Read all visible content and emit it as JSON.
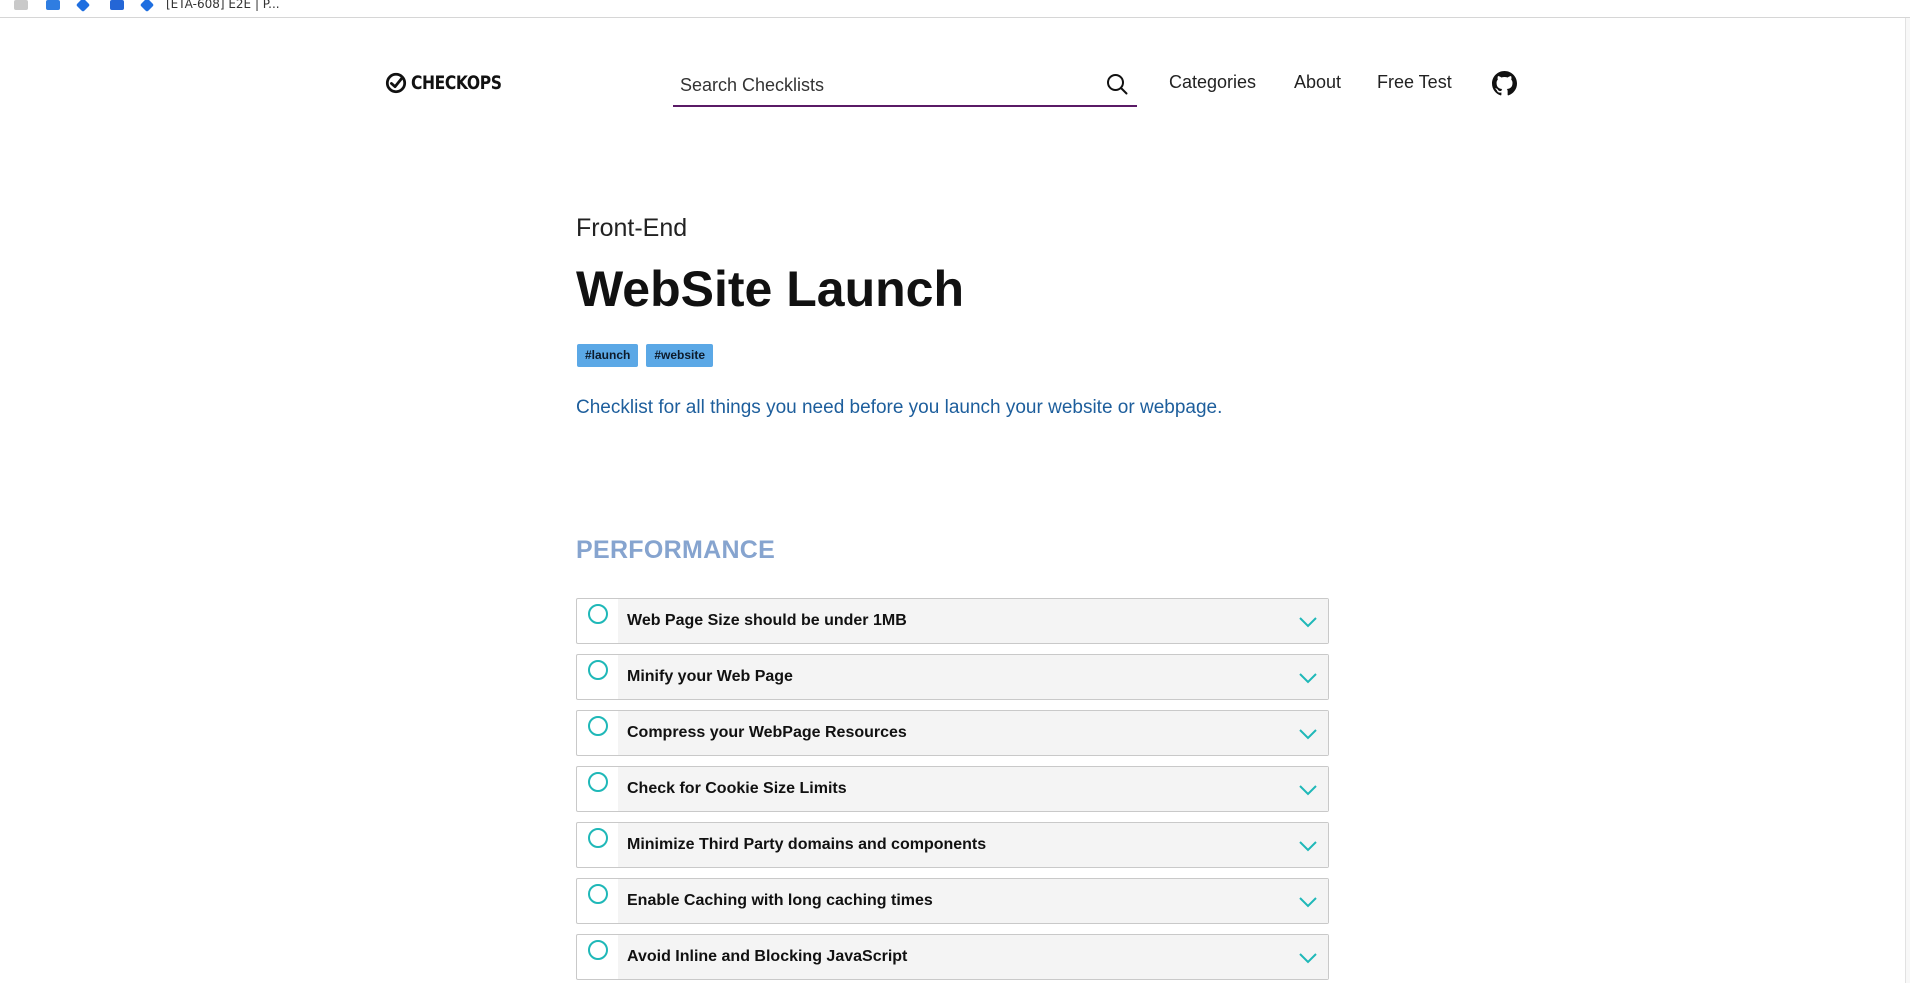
{
  "bookmarks_bar": {
    "last_tab_title": "[ETA-608] E2E | P..."
  },
  "header": {
    "logo_text": "CHECKOPS",
    "search_placeholder": "Search Checklists",
    "nav": {
      "categories": "Categories",
      "about": "About",
      "free_test": "Free Test"
    }
  },
  "page": {
    "category": "Front-End",
    "title": "WebSite Launch",
    "tags": [
      "#launch",
      "#website"
    ],
    "description": "Checklist for all things you need before you launch your website or webpage."
  },
  "section": {
    "title": "PERFORMANCE",
    "items": [
      "Web Page Size should be under 1MB",
      "Minify your Web Page",
      "Compress your WebPage Resources",
      "Check for Cookie Size Limits",
      "Minimize Third Party domains and components",
      "Enable Caching with long caching times",
      "Avoid Inline and Blocking JavaScript"
    ]
  },
  "colors": {
    "search_underline": "#5a1a66",
    "tag_bg": "#5ba8e6",
    "description": "#1d5e9c",
    "section_title": "#86a4cf",
    "check_accent": "#1fb8b8"
  }
}
